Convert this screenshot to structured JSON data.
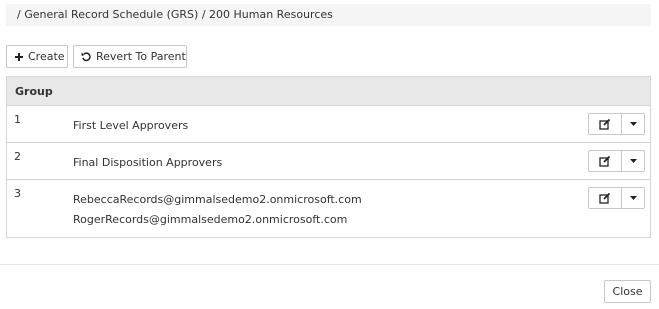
{
  "breadcrumb": "/ General Record Schedule (GRS) / 200 Human Resources",
  "toolbar": {
    "create_label": "Create",
    "revert_label": "Revert To Parent"
  },
  "table": {
    "header": "Group",
    "rows": [
      {
        "number": "1",
        "lines": [
          "First Level Approvers"
        ]
      },
      {
        "number": "2",
        "lines": [
          "Final Disposition Approvers"
        ]
      },
      {
        "number": "3",
        "lines": [
          "RebeccaRecords@gimmalsedemo2.onmicrosoft.com",
          "RogerRecords@gimmalsedemo2.onmicrosoft.com"
        ]
      }
    ]
  },
  "footer": {
    "close_label": "Close"
  }
}
